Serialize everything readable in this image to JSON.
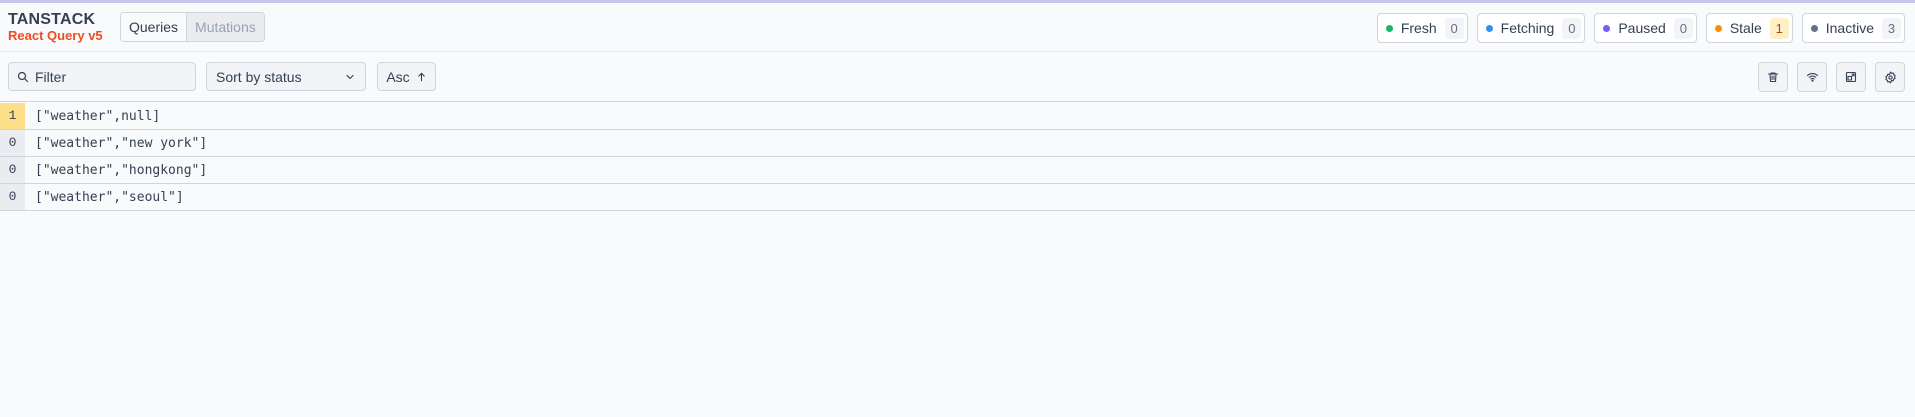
{
  "header": {
    "logo_title": "TANSTACK",
    "logo_subtitle": "React Query v5",
    "tabs": [
      {
        "label": "Queries",
        "active": true
      },
      {
        "label": "Mutations",
        "active": false
      }
    ],
    "statuses": [
      {
        "label": "Fresh",
        "count": "0",
        "color": "#12b76a"
      },
      {
        "label": "Fetching",
        "count": "0",
        "color": "#2e90fa"
      },
      {
        "label": "Paused",
        "count": "0",
        "color": "#7a5af8"
      },
      {
        "label": "Stale",
        "count": "1",
        "color": "#f79009",
        "count_bg": "#fef0c7",
        "count_color": "#b54708"
      },
      {
        "label": "Inactive",
        "count": "3",
        "color": "#667085"
      }
    ]
  },
  "toolbar": {
    "filter_placeholder": "Filter",
    "sort_label": "Sort by status",
    "order_label": "Asc",
    "icons": [
      "trash-icon",
      "wifi-icon",
      "picture-in-picture-icon",
      "settings-icon"
    ]
  },
  "queries": [
    {
      "count": "1",
      "key": "[\"weather\",null]",
      "stale": true
    },
    {
      "count": "0",
      "key": "[\"weather\",\"new york\"]",
      "stale": false
    },
    {
      "count": "0",
      "key": "[\"weather\",\"hongkong\"]",
      "stale": false
    },
    {
      "count": "0",
      "key": "[\"weather\",\"seoul\"]",
      "stale": false
    }
  ]
}
